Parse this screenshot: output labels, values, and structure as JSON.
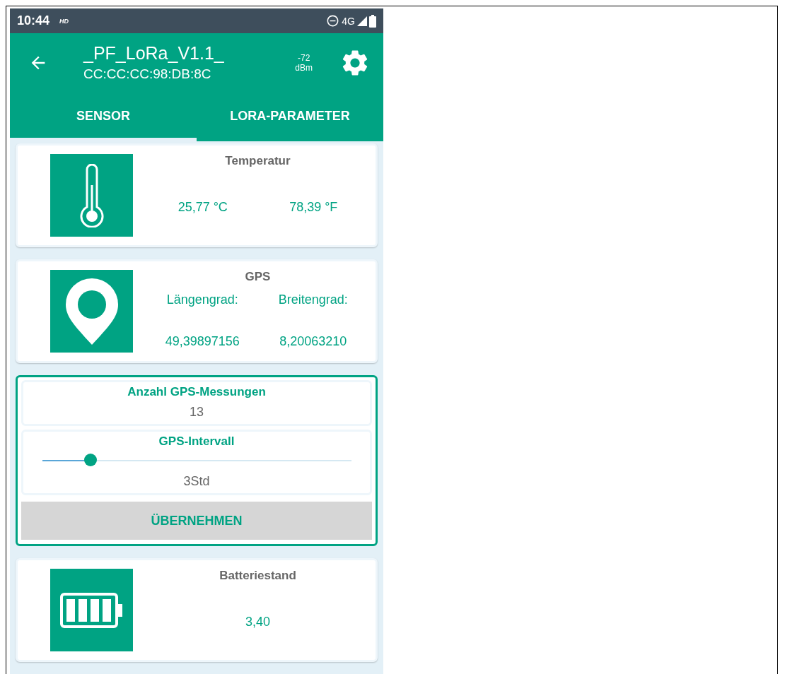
{
  "status_bar": {
    "time": "10:44",
    "hd": "HD",
    "network": "4G"
  },
  "header": {
    "title": "_PF_LoRa_V1.1_",
    "subtitle": "CC:CC:CC:98:DB:8C",
    "signal": "-72",
    "signal_unit": "dBm"
  },
  "tabs": [
    {
      "label": "SENSOR",
      "selected": true
    },
    {
      "label": "LORA-PARAMETER",
      "selected": false
    }
  ],
  "cards": [
    {
      "kind": "temperature",
      "title": "Temperatur",
      "values": [
        "25,77 °C",
        "78,39 °F"
      ]
    },
    {
      "kind": "gps",
      "title": "GPS",
      "columns": [
        {
          "label": "Längengrad:",
          "value": "49,39897156"
        },
        {
          "label": "Breitengrad:",
          "value": "8,20063210"
        }
      ]
    },
    {
      "kind": "settings",
      "count": {
        "label": "Anzahl GPS-Messungen",
        "value": "13"
      },
      "interval": {
        "label": "GPS-Intervall",
        "level": 0.156,
        "value": "3Std"
      },
      "button": "ÜBERNEHMEN"
    },
    {
      "kind": "battery",
      "title": "Batteriestand",
      "values": [
        "3,40"
      ]
    }
  ]
}
